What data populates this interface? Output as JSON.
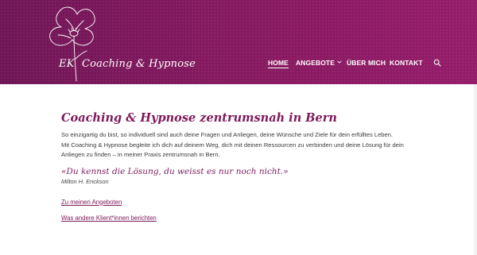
{
  "header": {
    "logo": {
      "initials": "EK",
      "name": "Coaching & Hypnose"
    },
    "nav": [
      {
        "label": "HOME",
        "active": true
      },
      {
        "label": "ANGEBOTE",
        "dropdown": true
      },
      {
        "label": "ÜBER MICH"
      },
      {
        "label": "KONTAKT"
      }
    ],
    "search_icon": "search-icon"
  },
  "main": {
    "headline": "Coaching & Hypnose zentrumsnah in Bern",
    "intro_line": "So einzigartig du bist, so individuell sind auch deine Fragen und Anliegen, deine Wünsche und Ziele für dein erfülltes Leben.",
    "body_line_1": "Mit Coaching & Hypnose begleite ich dich auf deinem Weg, dich mit deinen Ressourcen zu verbinden und deine Lösung für dein",
    "body_line_2": "Anliegen zu finden – in meiner Praxis zentrumsnah in Bern.",
    "quote": "«Du kennst die Lösung, du weisst es nur noch nicht.»",
    "quote_author": "Milton H. Erickson",
    "links": [
      {
        "label": "Zu meinen Angeboten"
      },
      {
        "label": "Was andere Klient*innen berichten"
      }
    ]
  },
  "colors": {
    "header_start": "#6f1656",
    "header_end": "#951c69",
    "accent": "#7d1a5b"
  }
}
